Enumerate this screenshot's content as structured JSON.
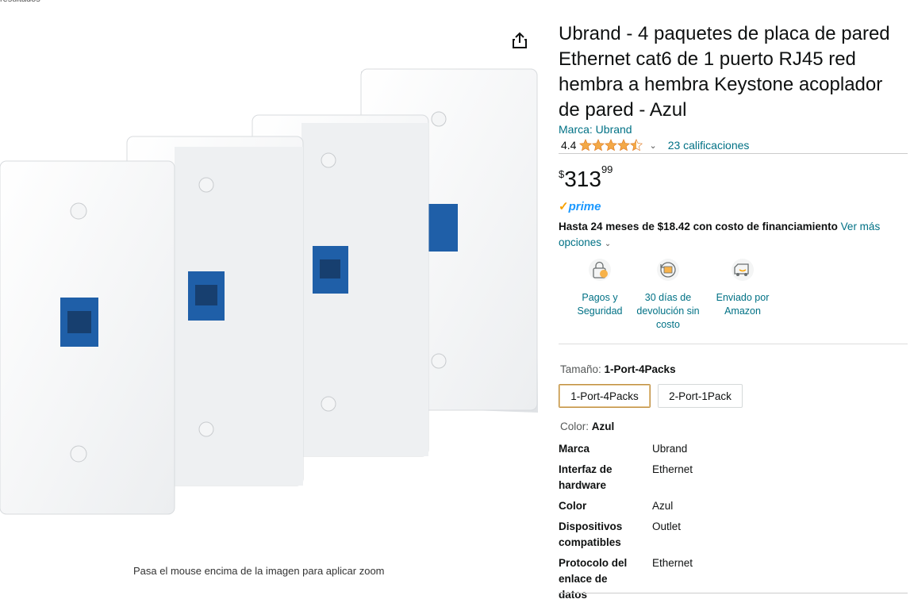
{
  "breadcrumb": "resultados",
  "product": {
    "title": "Ubrand - 4 paquetes de placa de pared Ethernet cat6 de 1 puerto RJ45 red hembra a hembra Keystone acoplador de pared - Azul",
    "brand_link": "Marca: Ubrand",
    "rating": "4.4",
    "ratings_count": "23 calificaciones",
    "price_symbol": "$",
    "price_whole": "313",
    "price_fraction": "99",
    "prime_label": "prime",
    "finance_bold": "Hasta 24 meses de $18.42 con costo de financiamiento",
    "finance_link": "Ver más opciones",
    "zoom_hint": "Pasa el mouse encima de la imagen para aplicar zoom"
  },
  "badges": [
    {
      "label": "Pagos y Seguridad",
      "icon": "secure-payment-icon"
    },
    {
      "label": "30 días de devolución sin costo",
      "icon": "returns-icon"
    },
    {
      "label": "Enviado por Amazon",
      "icon": "delivery-truck-icon"
    }
  ],
  "size": {
    "label": "Tamaño: ",
    "selected": "1-Port-4Packs",
    "options": [
      "1-Port-4Packs",
      "2-Port-1Pack"
    ]
  },
  "color": {
    "label": "Color: ",
    "value": "Azul"
  },
  "specs": [
    {
      "k": "Marca",
      "v": "Ubrand"
    },
    {
      "k": "Interfaz de hardware",
      "v": "Ethernet"
    },
    {
      "k": "Color",
      "v": "Azul"
    },
    {
      "k": "Dispositivos compatibles",
      "v": "Outlet"
    },
    {
      "k": "Protocolo del enlace de datos",
      "v": "Ethernet"
    }
  ],
  "colors": {
    "link": "#007185",
    "star": "#f3a847",
    "prime": "#1a98ff",
    "port_blue": "#1f5fa8"
  }
}
